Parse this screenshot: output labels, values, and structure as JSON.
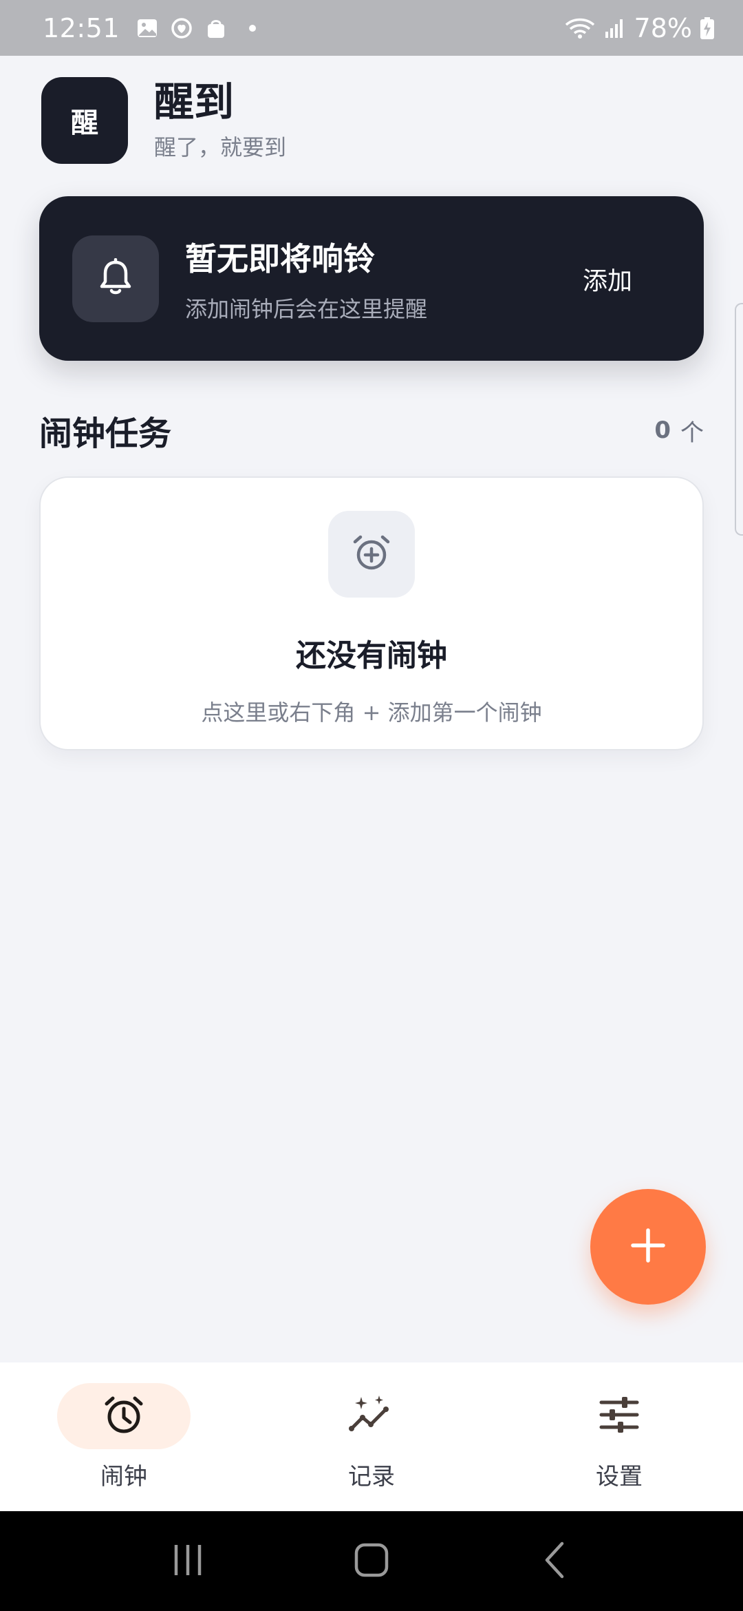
{
  "status_bar": {
    "time": "12:51",
    "battery": "78%",
    "left_icons": [
      "image-icon",
      "sync-heart-icon",
      "shopping-bag-icon",
      "dot-icon"
    ],
    "right_icons": [
      "wifi-icon",
      "signal-icon",
      "battery-charging-icon"
    ]
  },
  "header": {
    "logo_text": "醒",
    "title": "醒到",
    "subtitle": "醒了，就要到"
  },
  "next_alarm": {
    "title": "暂无即将响铃",
    "subtitle": "添加闹钟后会在这里提醒",
    "add_label": "添加",
    "icon": "bell-icon"
  },
  "alarm_section": {
    "title": "闹钟任务",
    "count": "0",
    "count_unit": "个"
  },
  "empty_state": {
    "icon": "alarm-add-icon",
    "title": "还没有闹钟",
    "subtitle": "点这里或右下角 + 添加第一个闹钟"
  },
  "fab": {
    "icon": "plus-icon"
  },
  "bottom_nav": {
    "items": [
      {
        "label": "闹钟",
        "icon": "alarm-clock-icon",
        "active": true
      },
      {
        "label": "记录",
        "icon": "sparkle-chart-icon",
        "active": false
      },
      {
        "label": "设置",
        "icon": "sliders-icon",
        "active": false
      }
    ]
  },
  "colors": {
    "background": "#F3F4F8",
    "dark_card": "#1A1D29",
    "accent": "#FF7A45",
    "active_pill": "#FFEFE6",
    "muted_text": "#7A7F8C"
  }
}
